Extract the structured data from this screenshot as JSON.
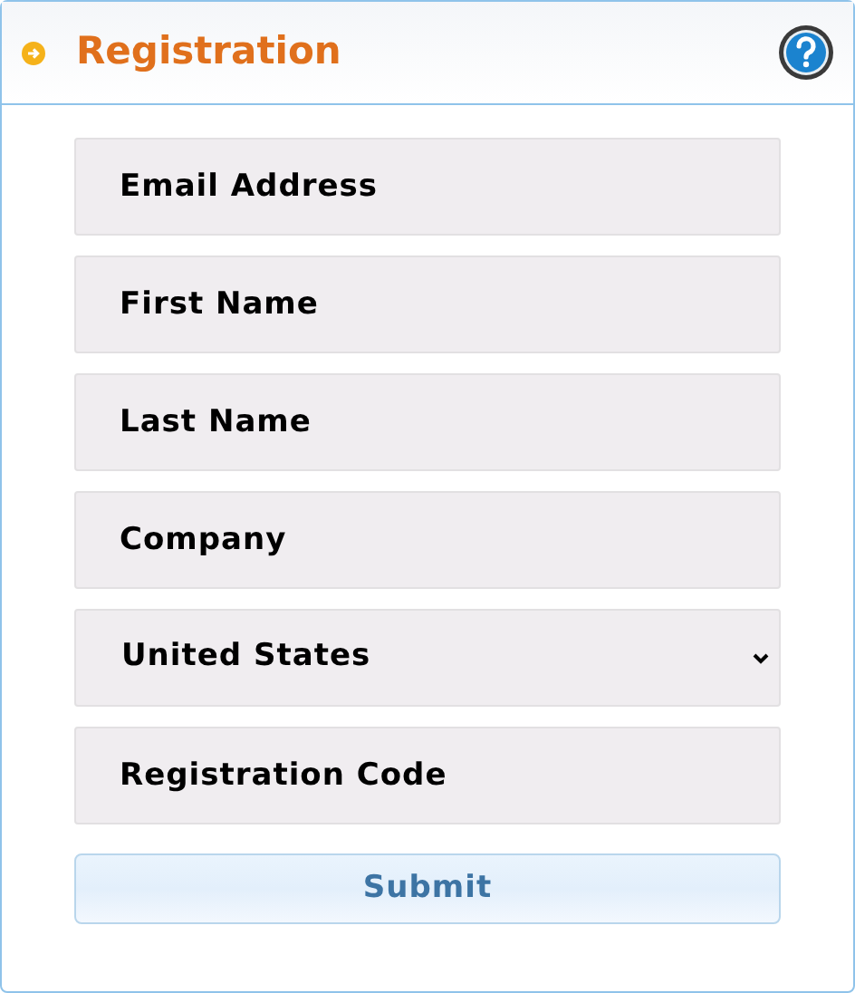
{
  "panel": {
    "title": "Registration"
  },
  "fields": [
    {
      "kind": "text",
      "placeholder": "Email Address"
    },
    {
      "kind": "text",
      "placeholder": "First Name"
    },
    {
      "kind": "text",
      "placeholder": "Last Name"
    },
    {
      "kind": "text",
      "placeholder": "Company"
    },
    {
      "kind": "select",
      "value": "United States"
    },
    {
      "kind": "text",
      "placeholder": "Registration Code"
    }
  ],
  "submit": {
    "label": "Submit"
  }
}
